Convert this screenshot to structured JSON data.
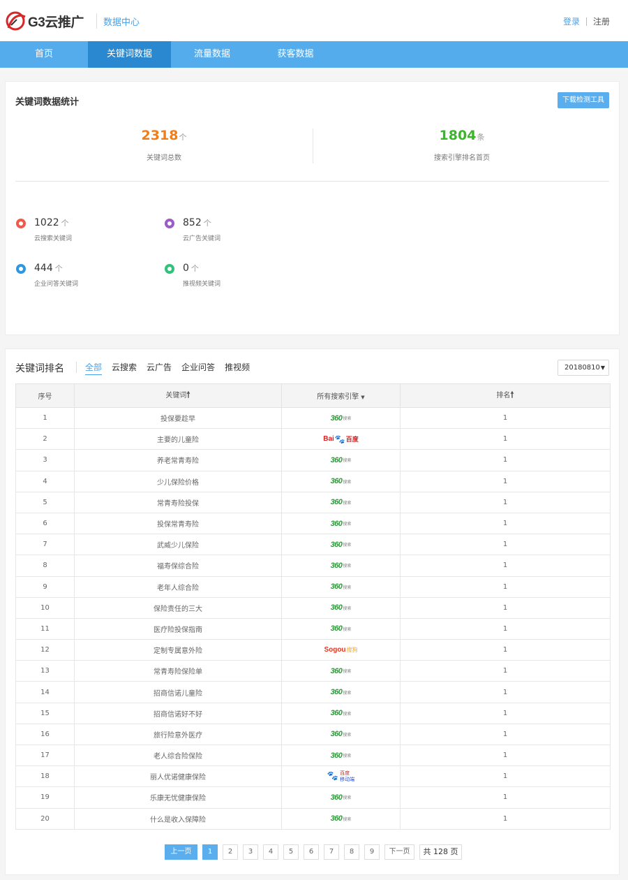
{
  "header": {
    "logo_text": "G3云推广",
    "subtitle": "数据中心",
    "login": "登录",
    "register": "注册"
  },
  "nav": {
    "items": [
      {
        "label": "首页"
      },
      {
        "label": "关键词数据"
      },
      {
        "label": "流量数据"
      },
      {
        "label": "获客数据"
      }
    ],
    "active_index": 1
  },
  "stats": {
    "title": "关键词数据统计",
    "download_button": "下载检测工具",
    "total": {
      "value": "2318",
      "unit": "个",
      "label": "关键词总数",
      "color": "#f07d1a"
    },
    "first_page": {
      "value": "1804",
      "unit": "条",
      "label": "搜索引擎排名首页",
      "color": "#3bb62a"
    },
    "categories": [
      {
        "value": "1022",
        "unit": "个",
        "label": "云搜索关键词",
        "color": "#f05a4a"
      },
      {
        "value": "852",
        "unit": "个",
        "label": "云广告关键词",
        "color": "#9a5cc6"
      },
      {
        "value": "444",
        "unit": "个",
        "label": "企业问答关键词",
        "color": "#2f97e0"
      },
      {
        "value": "0",
        "unit": "个",
        "label": "推视频关键词",
        "color": "#2ec27a"
      }
    ]
  },
  "ranking": {
    "title": "关键词排名",
    "filters": [
      "全部",
      "云搜索",
      "云广告",
      "企业问答",
      "推视频"
    ],
    "active_filter": 0,
    "date": "20180810",
    "columns": {
      "index": "序号",
      "keyword": "关键词",
      "engine": "所有搜索引擎",
      "rank": "排名"
    },
    "rows": [
      {
        "index": "1",
        "keyword": "投保要趁早",
        "engine": "360",
        "rank": "1"
      },
      {
        "index": "2",
        "keyword": "主要的儿童险",
        "engine": "baidu",
        "rank": "1"
      },
      {
        "index": "3",
        "keyword": "养老常青寿险",
        "engine": "360",
        "rank": "1"
      },
      {
        "index": "4",
        "keyword": "少儿保险价格",
        "engine": "360",
        "rank": "1"
      },
      {
        "index": "5",
        "keyword": "常青寿险投保",
        "engine": "360",
        "rank": "1"
      },
      {
        "index": "6",
        "keyword": "投保常青寿险",
        "engine": "360",
        "rank": "1"
      },
      {
        "index": "7",
        "keyword": "武威少儿保险",
        "engine": "360",
        "rank": "1"
      },
      {
        "index": "8",
        "keyword": "福寿保综合险",
        "engine": "360",
        "rank": "1"
      },
      {
        "index": "9",
        "keyword": "老年人综合险",
        "engine": "360",
        "rank": "1"
      },
      {
        "index": "10",
        "keyword": "保险责任的三大",
        "engine": "360",
        "rank": "1"
      },
      {
        "index": "11",
        "keyword": "医疗险投保指南",
        "engine": "360",
        "rank": "1"
      },
      {
        "index": "12",
        "keyword": "定制专属意外险",
        "engine": "sogou",
        "rank": "1"
      },
      {
        "index": "13",
        "keyword": "常青寿险保险单",
        "engine": "360",
        "rank": "1"
      },
      {
        "index": "14",
        "keyword": "招商信诺儿童险",
        "engine": "360",
        "rank": "1"
      },
      {
        "index": "15",
        "keyword": "招商信诺好不好",
        "engine": "360",
        "rank": "1"
      },
      {
        "index": "16",
        "keyword": "旅行险意外医疗",
        "engine": "360",
        "rank": "1"
      },
      {
        "index": "17",
        "keyword": "老人综合险保险",
        "engine": "360",
        "rank": "1"
      },
      {
        "index": "18",
        "keyword": "丽人优诺健康保险",
        "engine": "baidu_mobile",
        "rank": "1"
      },
      {
        "index": "19",
        "keyword": "乐康无忧健康保险",
        "engine": "360",
        "rank": "1"
      },
      {
        "index": "20",
        "keyword": "什么是收入保障险",
        "engine": "360",
        "rank": "1"
      }
    ],
    "engine_logos": {
      "360": {
        "n": "360",
        "s": "搜索"
      },
      "baidu": {
        "b1": "Bai",
        "b2": "百度"
      },
      "sogou": {
        "so": "Sogou",
        "gou": "搜狗"
      },
      "baidu_mobile": {
        "t1": "百度",
        "t2": "移动端"
      }
    }
  },
  "pagination": {
    "prev": "上一页",
    "pages": [
      "1",
      "2",
      "3",
      "4",
      "5",
      "6",
      "7",
      "8",
      "9"
    ],
    "current": "1",
    "next": "下一页",
    "total": "共 128 页"
  }
}
